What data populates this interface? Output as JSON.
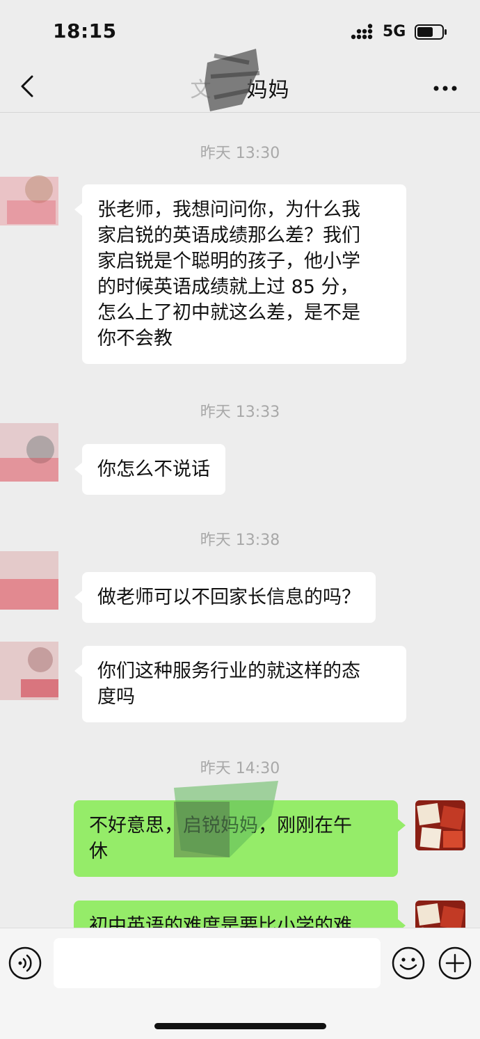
{
  "status_bar": {
    "time": "18:15",
    "network": "5G",
    "signal_icon": "signal-bars-icon",
    "battery_icon": "battery-icon"
  },
  "nav": {
    "back_icon": "chevron-left-icon",
    "title": "妈妈",
    "more_icon": "more-dots-icon"
  },
  "messages": [
    {
      "type": "timestamp",
      "text": "昨天 13:30"
    },
    {
      "type": "incoming",
      "text": "张老师，我想问问你，为什么我\n家启锐的英语成绩那么差？我们\n家启锐是个聪明的孩子，他小学\n的时候英语成绩就上过 85 分，\n怎么上了初中就这么差，是不是\n你不会教"
    },
    {
      "type": "timestamp",
      "text": "昨天 13:33"
    },
    {
      "type": "incoming",
      "text": "你怎么不说话"
    },
    {
      "type": "timestamp",
      "text": "昨天 13:38"
    },
    {
      "type": "incoming",
      "text": "做老师可以不回家长信息的吗？"
    },
    {
      "type": "incoming",
      "text": "你们这种服务行业的就这样的态\n度吗"
    },
    {
      "type": "timestamp",
      "text": "昨天 14:30"
    },
    {
      "type": "outgoing",
      "text": "不好意思，启锐妈妈，刚刚在午\n休"
    },
    {
      "type": "outgoing",
      "text": "初中英语的难度是要比小学的难"
    }
  ],
  "input_bar": {
    "voice_icon": "voice-icon",
    "input_value": "",
    "emoji_icon": "emoji-icon",
    "plus_icon": "plus-icon"
  },
  "colors": {
    "background": "#ededed",
    "incoming_bubble": "#ffffff",
    "outgoing_bubble": "#95ec69",
    "timestamp_text": "#a8a8a8"
  }
}
